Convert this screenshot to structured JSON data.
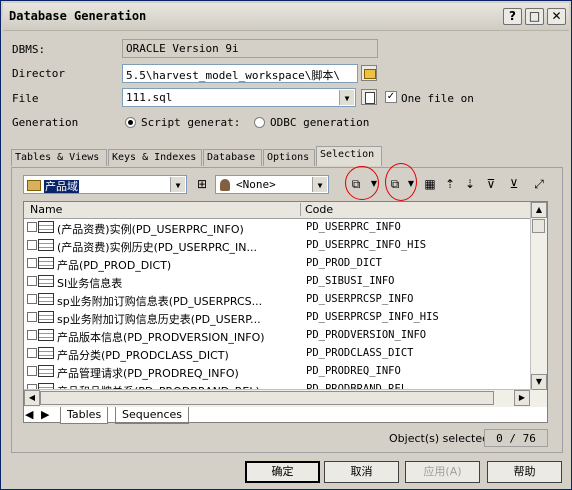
{
  "window": {
    "title": "Database Generation"
  },
  "form": {
    "dbms_label": "DBMS:",
    "dbms_value": "ORACLE Version 9i",
    "director_label": "Director",
    "director_value": "5.5\\harvest_model_workspace\\脚本\\",
    "file_label": "File",
    "file_value": "111.sql",
    "one_file_label": "One file on",
    "one_file_checked": true,
    "generation_label": "Generation",
    "script_label": "Script generat:",
    "odbc_label": "ODBC generation"
  },
  "tabs": [
    "Tables & Views",
    "Keys & Indexes",
    "Database",
    "Options",
    "Selection"
  ],
  "active_tab": "Selection",
  "selection": {
    "package_value": "产品域",
    "owner_value": "<None>",
    "columns": [
      "Name",
      "Code"
    ],
    "rows": [
      {
        "name": "(产品资费)实例(PD_USERPRC_INFO)",
        "code": "PD_USERPRC_INFO"
      },
      {
        "name": "(产品资费)实例历史(PD_USERPRC_IN...",
        "code": "PD_USERPRC_INFO_HIS"
      },
      {
        "name": "产品(PD_PROD_DICT)",
        "code": "PD_PROD_DICT"
      },
      {
        "name": "SI业务信息表",
        "code": "PD_SIBUSI_INFO"
      },
      {
        "name": "sp业务附加订购信息表(PD_USERPRCS...",
        "code": "PD_USERPRCSP_INFO"
      },
      {
        "name": "sp业务附加订购信息历史表(PD_USERP...",
        "code": "PD_USERPRCSP_INFO_HIS"
      },
      {
        "name": "产品版本信息(PD_PRODVERSION_INFO)",
        "code": "PD_PRODVERSION_INFO"
      },
      {
        "name": "产品分类(PD_PRODCLASS_DICT)",
        "code": "PD_PRODCLASS_DICT"
      },
      {
        "name": "产品管理请求(PD_PRODREQ_INFO)",
        "code": "PD_PRODREQ_INFO"
      },
      {
        "name": "产品和品牌关系(PD_PRODBRAND_REL)",
        "code": "PD_PRODBRAND_REL"
      }
    ],
    "bottom_tabs": [
      "Tables",
      "Sequences"
    ],
    "status_label": "Object(s) selected:",
    "status_value": "0 / 76"
  },
  "buttons": {
    "ok": "确定",
    "cancel": "取消",
    "apply": "应用(A)",
    "help": "帮助"
  },
  "colors": {
    "annotation_circle": "#e00000"
  }
}
